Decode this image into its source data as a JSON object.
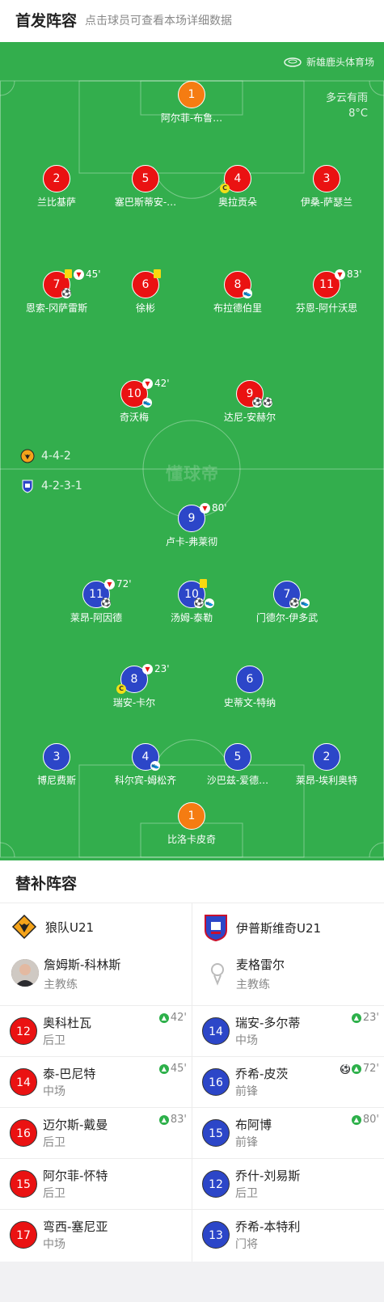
{
  "header": {
    "title": "首发阵容",
    "subtitle": "点击球员可查看本场详细数据"
  },
  "pitch": {
    "stadium": "新雄鹿头体育场",
    "weather": {
      "condition": "多云有雨",
      "temp": "8°C"
    },
    "watermark": "懂球帝",
    "formations": {
      "home": "4-4-2",
      "away": "4-2-3-1"
    }
  },
  "home_lineup": [
    {
      "number": "1",
      "name": "阿尔菲-布鲁…",
      "gk": true
    },
    {
      "number": "2",
      "name": "兰比基萨"
    },
    {
      "number": "5",
      "name": "塞巴斯蒂安-…"
    },
    {
      "number": "4",
      "name": "奥拉贡朵",
      "captain": true
    },
    {
      "number": "3",
      "name": "伊桑-萨瑟兰"
    },
    {
      "number": "7",
      "name": "恩索-冈萨雷斯",
      "yellow": true,
      "sub_out": "45'",
      "goals": 1
    },
    {
      "number": "6",
      "name": "徐彬",
      "yellow": true
    },
    {
      "number": "8",
      "name": "布拉德伯里",
      "assists": 1
    },
    {
      "number": "11",
      "name": "芬恩-阿什沃思",
      "sub_out": "83'"
    },
    {
      "number": "10",
      "name": "奇沃梅",
      "sub_out": "42'",
      "assists": 1
    },
    {
      "number": "9",
      "name": "达尼-安赫尔",
      "goals": 2
    }
  ],
  "away_lineup": [
    {
      "number": "9",
      "name": "卢卡-弗莱彻",
      "sub_out": "80'"
    },
    {
      "number": "11",
      "name": "莱昂-阿因德",
      "sub_out": "72'",
      "goals": 1
    },
    {
      "number": "10",
      "name": "汤姆-泰勒",
      "yellow": true,
      "goals": 1,
      "assists": 1
    },
    {
      "number": "7",
      "name": "门德尔-伊多武",
      "goals": 1,
      "assists": 1
    },
    {
      "number": "8",
      "name": "瑞安-卡尔",
      "sub_out": "23'",
      "captain": true
    },
    {
      "number": "6",
      "name": "史蒂文-特纳"
    },
    {
      "number": "3",
      "name": "博尼费斯"
    },
    {
      "number": "4",
      "name": "科尔宾-姆松齐",
      "assists": 1
    },
    {
      "number": "5",
      "name": "沙巴兹-爱德…"
    },
    {
      "number": "2",
      "name": "莱昂-埃利奥特"
    },
    {
      "number": "1",
      "name": "比洛卡皮奇",
      "gk": true
    }
  ],
  "subs": {
    "title": "替补阵容",
    "home": {
      "team": "狼队U21",
      "coach": {
        "name": "詹姆斯-科林斯",
        "role": "主教练"
      },
      "players": [
        {
          "number": "12",
          "name": "奥科杜瓦",
          "pos": "后卫",
          "sub_in": "42'"
        },
        {
          "number": "14",
          "name": "泰-巴尼特",
          "pos": "中场",
          "sub_in": "45'"
        },
        {
          "number": "16",
          "name": "迈尔斯-戴曼",
          "pos": "后卫",
          "sub_in": "83'"
        },
        {
          "number": "15",
          "name": "阿尔菲-怀特",
          "pos": "后卫"
        },
        {
          "number": "17",
          "name": "弯西-塞尼亚",
          "pos": "中场"
        }
      ]
    },
    "away": {
      "team": "伊普斯维奇U21",
      "coach": {
        "name": "麦格雷尔",
        "role": "主教练"
      },
      "players": [
        {
          "number": "14",
          "name": "瑞安-多尔蒂",
          "pos": "中场",
          "sub_in": "23'"
        },
        {
          "number": "16",
          "name": "乔希-皮茨",
          "pos": "前锋",
          "sub_in": "72'",
          "goal": true
        },
        {
          "number": "15",
          "name": "布阿博",
          "pos": "前锋",
          "sub_in": "80'"
        },
        {
          "number": "12",
          "name": "乔什-刘易斯",
          "pos": "后卫"
        },
        {
          "number": "13",
          "name": "乔希-本特利",
          "pos": "门将"
        }
      ]
    }
  },
  "colors": {
    "pitch": "#33ae4d",
    "home": "#ea1212",
    "away": "#2c46c8",
    "gk": "#f57c12"
  }
}
